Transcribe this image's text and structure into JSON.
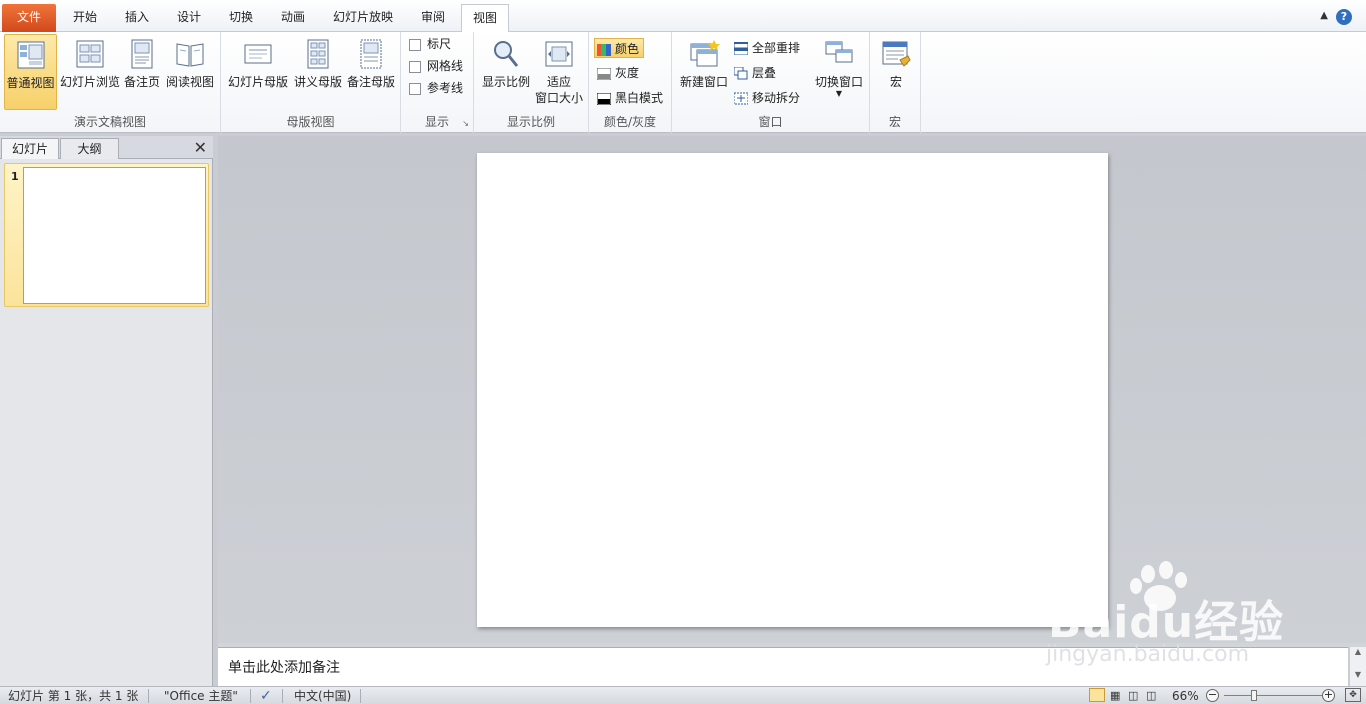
{
  "tabs": [
    {
      "label": "文件"
    },
    {
      "label": "开始"
    },
    {
      "label": "插入"
    },
    {
      "label": "设计"
    },
    {
      "label": "切换"
    },
    {
      "label": "动画"
    },
    {
      "label": "幻灯片放映"
    },
    {
      "label": "审阅"
    },
    {
      "label": "视图"
    }
  ],
  "active_tab": "视图",
  "ribbon": {
    "presentation_views": {
      "label": "演示文稿视图",
      "normal": "普通视图",
      "slide_sorter": "幻灯片浏览",
      "notes_page": "备注页",
      "reading_view": "阅读视图"
    },
    "master_views": {
      "label": "母版视图",
      "slide_master": "幻灯片母版",
      "handout_master": "讲义母版",
      "notes_master": "备注母版"
    },
    "show": {
      "label": "显示",
      "ruler": "标尺",
      "gridlines": "网格线",
      "guides": "参考线"
    },
    "zoom": {
      "label": "显示比例",
      "zoom": "显示比例",
      "fit_line1": "适应",
      "fit_line2": "窗口大小"
    },
    "color": {
      "label": "颜色/灰度",
      "color": "颜色",
      "grayscale": "灰度",
      "bw": "黑白模式"
    },
    "window": {
      "label": "窗口",
      "new_window": "新建窗口",
      "arrange_all": "全部重排",
      "cascade": "层叠",
      "move_split": "移动拆分",
      "switch_windows": "切换窗口"
    },
    "macros": {
      "label": "宏",
      "macros": "宏"
    }
  },
  "left_pane": {
    "tab_slides": "幻灯片",
    "tab_outline": "大纲",
    "slide_number": "1"
  },
  "notes_placeholder": "单击此处添加备注",
  "status": {
    "slide_info": "幻灯片 第 1 张，共 1 张",
    "theme": "\"Office 主题\"",
    "language": "中文(中国)",
    "zoom": "66%",
    "zoom_minus": "−",
    "zoom_plus": "+"
  },
  "watermark": {
    "brand": "Baidu经验",
    "url": "jingyan.baidu.com"
  },
  "colors": {
    "file_tab": "#d2491b",
    "selected": "#f7d06a"
  }
}
